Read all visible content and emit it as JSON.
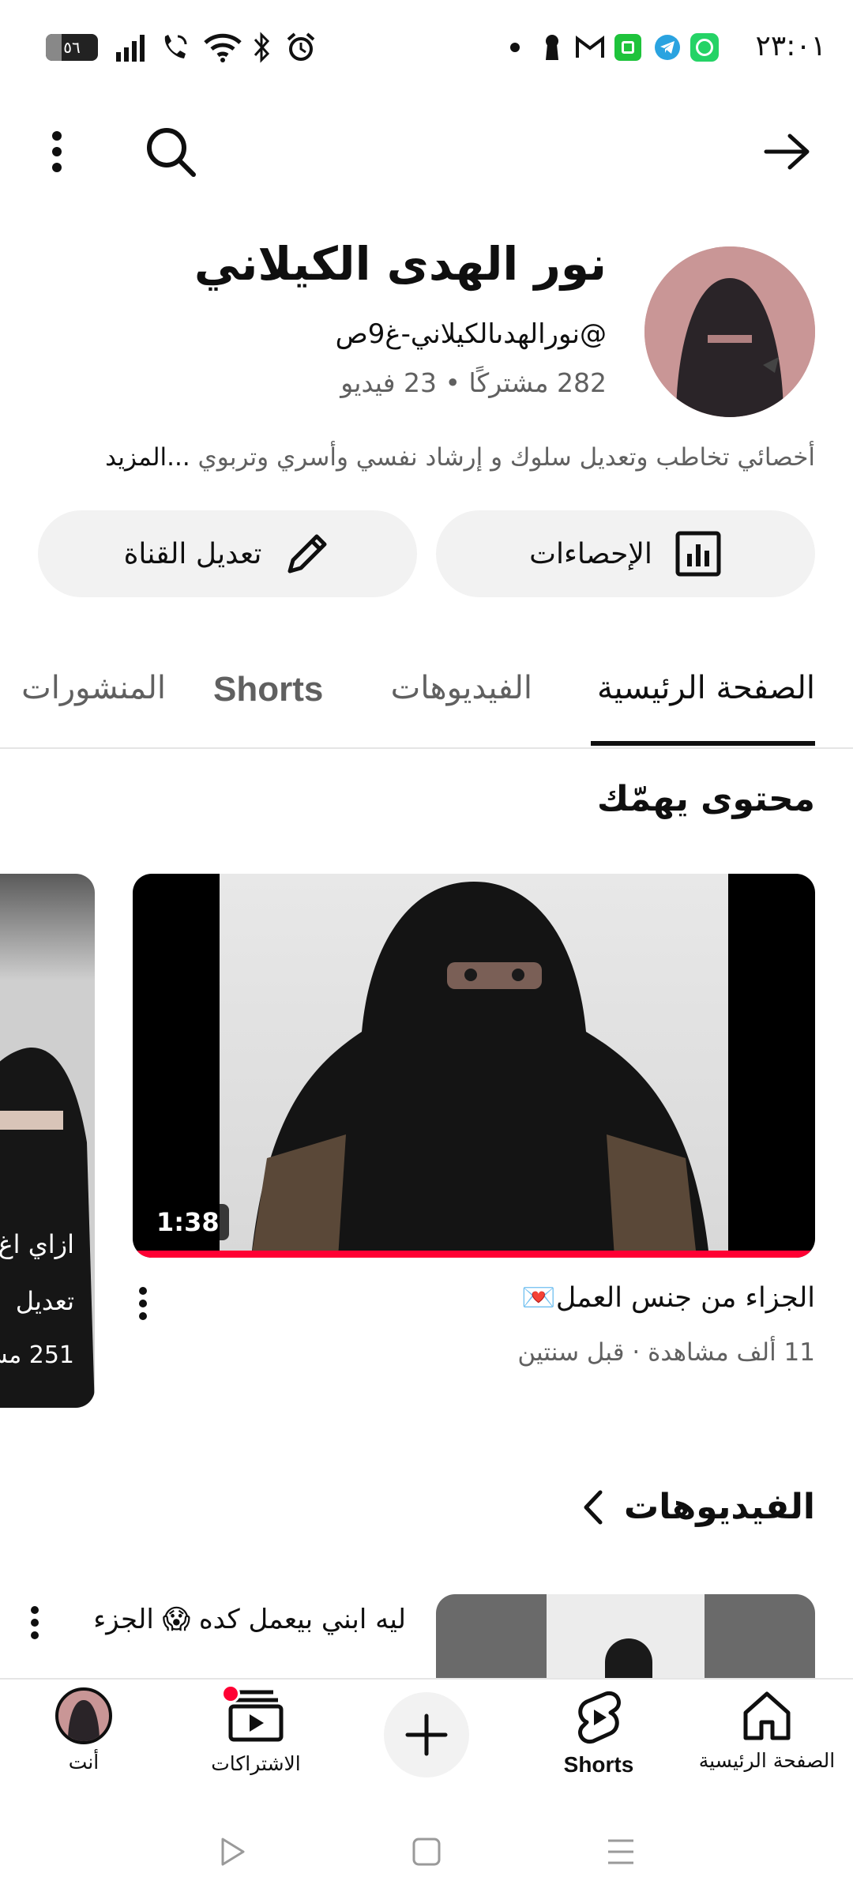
{
  "status_bar": {
    "time": "٢٣:٠١",
    "battery": "٥٦"
  },
  "channel": {
    "name": "نور الهدى الكيلاني",
    "handle": "@نورالهدىالكيلاني-غ9ص",
    "stats": "282 مشتركًا • 23 فيديو",
    "description": "أخصائي تخاطب وتعديل سلوك و إرشاد نفسي وأسري وتربوي",
    "more": "...المزيد"
  },
  "actions": {
    "stats_label": "الإحصاءات",
    "edit_label": "تعديل القناة"
  },
  "tabs": [
    {
      "label": "الصفحة الرئيسية",
      "active": true
    },
    {
      "label": "الفيديوهات",
      "active": false
    },
    {
      "label": "Shorts",
      "active": false
    },
    {
      "label": "المنشورات",
      "active": false
    }
  ],
  "for_you": {
    "title": "محتوى يهمّك",
    "featured": {
      "duration": "1:38",
      "title": "الجزاء من جنس العمل💌",
      "meta": "11 ألف مشاهدة · قبل سنتين",
      "progress": 1.0
    },
    "side_card": {
      "line1": "ازاي اغ",
      "line2": "تعديل",
      "line3": "251 مش"
    }
  },
  "videos_section": {
    "title": "الفيديوهات",
    "first_title": "ليه ابني بيعمل كده 😱 الجزء"
  },
  "bottom_nav": {
    "home": "الصفحة الرئيسية",
    "shorts": "Shorts",
    "subscriptions": "الاشتراكات",
    "you": "أنت"
  },
  "colors": {
    "accent": "#ff0033",
    "whatsapp": "#25d366",
    "telegram": "#2aa3e0",
    "green_app": "#1ec33b"
  }
}
